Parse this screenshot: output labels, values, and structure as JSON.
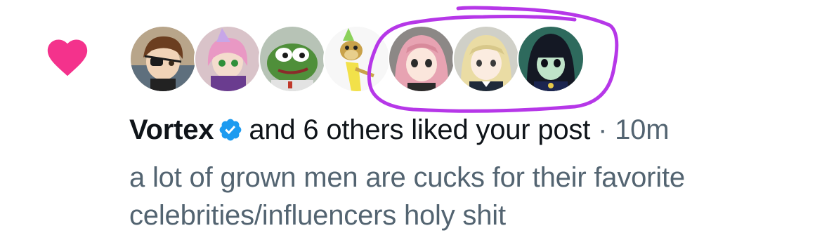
{
  "notification": {
    "type_icon": "heart-icon",
    "icon_color": "#f91880",
    "annotation_color": "#b637e8",
    "avatars": [
      {
        "name": "avatar-eyepatch-boy",
        "bg": "#c9b59a"
      },
      {
        "name": "avatar-pink-hair-girl",
        "bg": "#d8c2c8"
      },
      {
        "name": "avatar-pepe-frog",
        "bg": "#b9c7b9"
      },
      {
        "name": "avatar-bored-ape",
        "bg": "#f3f3f3"
      },
      {
        "name": "avatar-pink-anime-girl",
        "bg": "#8e8a88"
      },
      {
        "name": "avatar-blonde-anime-girl",
        "bg": "#cfcfc8"
      },
      {
        "name": "avatar-green-anime-girl",
        "bg": "#2f6b5e"
      }
    ],
    "user": "Vortex",
    "verified_icon": "verified-badge-icon",
    "action_text": "and 6 others liked your post",
    "separator": "·",
    "time": "10m",
    "post_text": "a lot of grown men are cucks for their favorite celebrities/influencers holy shit"
  }
}
